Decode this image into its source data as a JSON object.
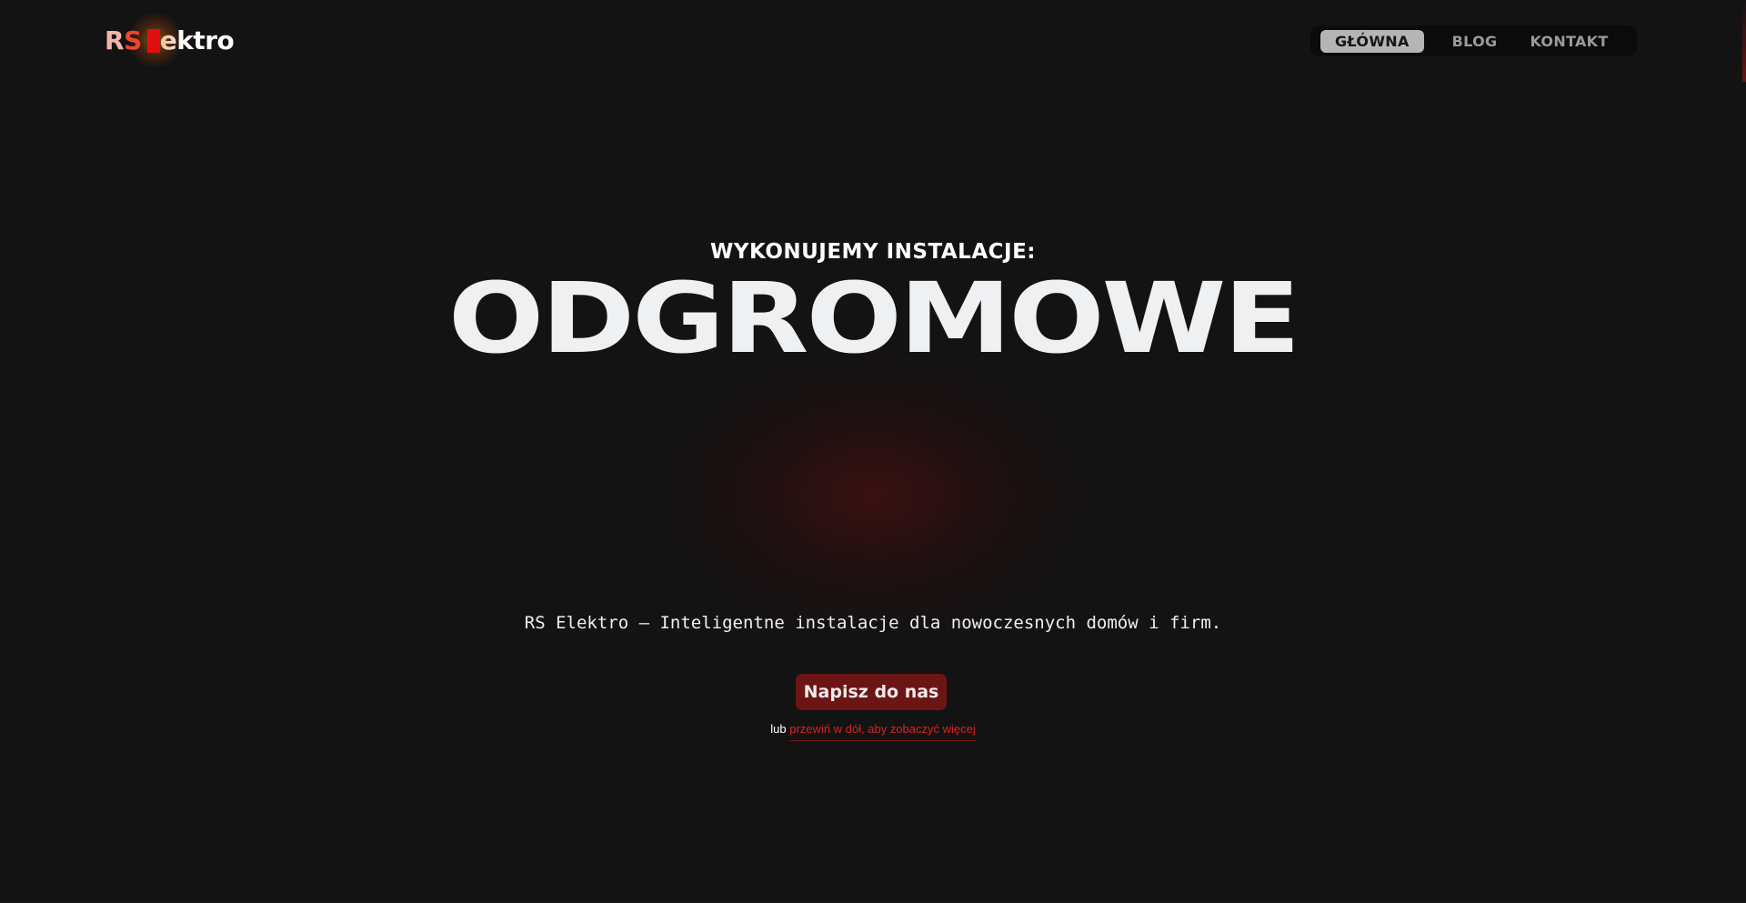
{
  "brand": {
    "part_r": "R",
    "part_s": "S",
    "part_rest": "ektro"
  },
  "nav": {
    "items": [
      {
        "label": "GŁÓWNA",
        "active": true
      },
      {
        "label": "BLOG",
        "active": false
      },
      {
        "label": "KONTAKT",
        "active": false
      }
    ]
  },
  "hero": {
    "subtitle": "WYKONUJEMY INSTALACJE:",
    "headline": "ODGROMOWE",
    "tagline": "RS Elektro – Inteligentne instalacje dla nowoczesnych domów i firm.",
    "cta_label": "Napisz do nas",
    "scroll_prefix": "lub",
    "scroll_link": "przewiń w dół, aby zobaczyć więcej"
  },
  "colors": {
    "background": "#131314",
    "accent_red": "#d9231f",
    "cta_background": "#6b1515",
    "headline": "#eef0f2"
  }
}
